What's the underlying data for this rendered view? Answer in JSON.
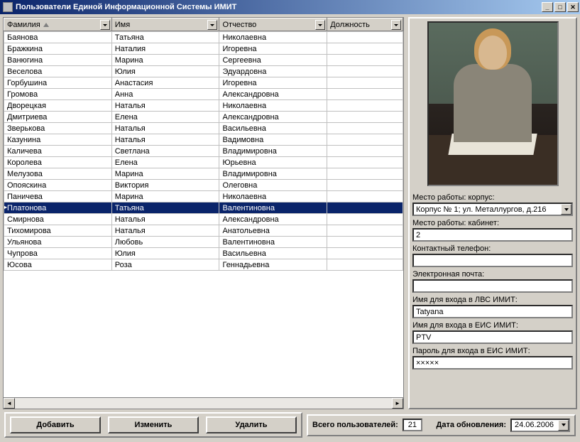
{
  "window": {
    "title": "Пользователи Единой Информационной Системы ИМИТ"
  },
  "grid": {
    "columns": [
      {
        "label": "Фамилия",
        "width": "27%",
        "sorted": true
      },
      {
        "label": "Имя",
        "width": "27%",
        "sorted": false
      },
      {
        "label": "Отчество",
        "width": "27%",
        "sorted": false
      },
      {
        "label": "Должность",
        "width": "19%",
        "sorted": false
      }
    ],
    "rows": [
      {
        "f": "Баянова",
        "i": "Татьяна",
        "o": "Николаевна",
        "d": ""
      },
      {
        "f": "Бражкина",
        "i": "Наталия",
        "o": "Игоревна",
        "d": ""
      },
      {
        "f": "Ванюгина",
        "i": "Марина",
        "o": "Сергеевна",
        "d": ""
      },
      {
        "f": "Веселова",
        "i": "Юлия",
        "o": "Эдуардовна",
        "d": ""
      },
      {
        "f": "Горбушина",
        "i": "Анастасия",
        "o": "Игоревна",
        "d": ""
      },
      {
        "f": "Громова",
        "i": "Анна",
        "o": "Александровна",
        "d": ""
      },
      {
        "f": "Дворецкая",
        "i": "Наталья",
        "o": "Николаевна",
        "d": ""
      },
      {
        "f": "Дмитриева",
        "i": "Елена",
        "o": "Александровна",
        "d": ""
      },
      {
        "f": "Зверькова",
        "i": "Наталья",
        "o": "Васильевна",
        "d": ""
      },
      {
        "f": "Казунина",
        "i": "Наталья",
        "o": "Вадимовна",
        "d": ""
      },
      {
        "f": "Каличева",
        "i": "Светлана",
        "o": "Владимировна",
        "d": ""
      },
      {
        "f": "Королева",
        "i": "Елена",
        "o": "Юрьевна",
        "d": ""
      },
      {
        "f": "Мелузова",
        "i": "Марина",
        "o": "Владимировна",
        "d": ""
      },
      {
        "f": "Опояскина",
        "i": "Виктория",
        "o": "Олеговна",
        "d": ""
      },
      {
        "f": "Паничева",
        "i": "Марина",
        "o": "Николаевна",
        "d": ""
      },
      {
        "f": "Платонова",
        "i": "Татьяна",
        "o": "Валентиновна",
        "d": "",
        "selected": true
      },
      {
        "f": "Смирнова",
        "i": "Наталья",
        "o": "Александровна",
        "d": ""
      },
      {
        "f": "Тихомирова",
        "i": "Наталья",
        "o": "Анатольевна",
        "d": ""
      },
      {
        "f": "Ульянова",
        "i": "Любовь",
        "o": "Валентиновна",
        "d": ""
      },
      {
        "f": "Чупрова",
        "i": "Юлия",
        "o": "Васильевна",
        "d": ""
      },
      {
        "f": "Юсова",
        "i": "Роза",
        "o": "Геннадьевна",
        "d": ""
      }
    ]
  },
  "buttons": {
    "add": "Добавить",
    "edit": "Изменить",
    "delete": "Удалить"
  },
  "details": {
    "workplace_building_label": "Место работы: корпус:",
    "workplace_building_value": "Корпус № 1; ул. Металлургов, д.216",
    "workplace_room_label": "Место работы: кабинет:",
    "workplace_room_value": "2",
    "phone_label": "Контактный телефон:",
    "phone_value": "",
    "email_label": "Электронная почта:",
    "email_value": "",
    "lvs_login_label": "Имя для входа в ЛВС ИМИТ:",
    "lvs_login_value": "Tatyana",
    "eis_login_label": "Имя для входа в ЕИС ИМИТ:",
    "eis_login_value": "PTV",
    "eis_pass_label": "Пароль для входа в ЕИС ИМИТ:",
    "eis_pass_value": "×××××"
  },
  "footer": {
    "total_label": "Всего пользователей:",
    "total_value": "21",
    "date_label": "Дата обновления:",
    "date_value": "24.06.2006"
  }
}
